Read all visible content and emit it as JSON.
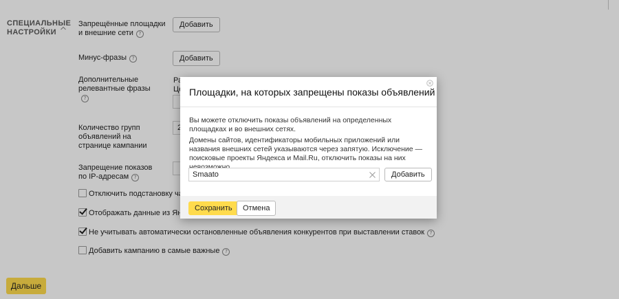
{
  "section": {
    "title": "СПЕЦИАЛЬНЫЕ НАСТРОЙКИ"
  },
  "help_glyph": "?",
  "settings": {
    "banned_sites": {
      "label": "Запрещённые площадки и внешние сети",
      "button": "Добавить"
    },
    "minus_phrases": {
      "label": "Минус-фразы",
      "button": "Добавить"
    },
    "extra_phrases": {
      "label": "Дополнительные релевантные фразы",
      "value_line1": "Ра",
      "value_line2": "Це"
    },
    "groups_count": {
      "label": "Количество групп объявлений на странице кампании",
      "value": "2"
    },
    "ip_block": {
      "label": "Запрещение показов по IP-адресам"
    }
  },
  "checkboxes": [
    {
      "label": "Отключить подстановку части те",
      "checked": false,
      "has_help": false
    },
    {
      "label": "Отображать данные из Яндекс.С",
      "checked": true,
      "has_help": false
    },
    {
      "label": "Не учитывать автоматически остановленные объявления конкурентов при выставлении ставок",
      "checked": true,
      "has_help": true
    },
    {
      "label": "Добавить кампанию в самые важные",
      "checked": false,
      "has_help": true
    }
  ],
  "next_button": "Дальше",
  "modal": {
    "title": "Площадки, на которых запрещены показы объявлений",
    "paragraph1": "Вы можете отключить показы объявлений на определенных площадках и во внешних сетях.",
    "paragraph2": "Домены сайтов, идентификаторы мобильных приложений или названия внешних сетей указываются через запятую. Исключение — поисковые проекты Яндекса и Mail.Ru, отключить показы на них невозможно.",
    "input_value": "Smaato",
    "add_button": "Добавить",
    "save_button": "Сохранить",
    "cancel_button": "Отмена"
  },
  "colors": {
    "accent": "#ffdb4d",
    "overlay": "rgba(0,0,0,0.22)"
  }
}
